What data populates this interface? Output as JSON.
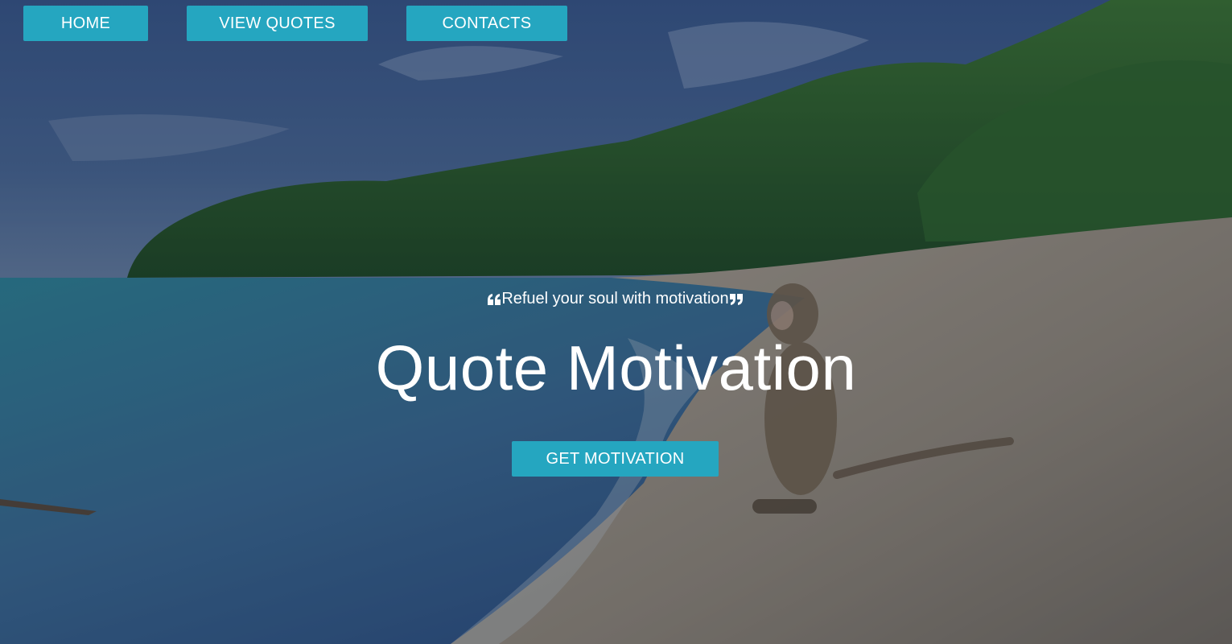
{
  "nav": {
    "home_label": "HOME",
    "quotes_label": "VIEW QUOTES",
    "contacts_label": "CONTACTS"
  },
  "hero": {
    "tagline": "Refuel your soul with motivation",
    "open_quote_icon": "open-quote-icon",
    "close_quote_icon": "close-quote-icon",
    "title": "Quote Motivation",
    "cta_label": "GET MOTIVATION"
  },
  "colors": {
    "accent": "#25a6c0",
    "text": "#ffffff",
    "overlay": "#141e3c"
  }
}
